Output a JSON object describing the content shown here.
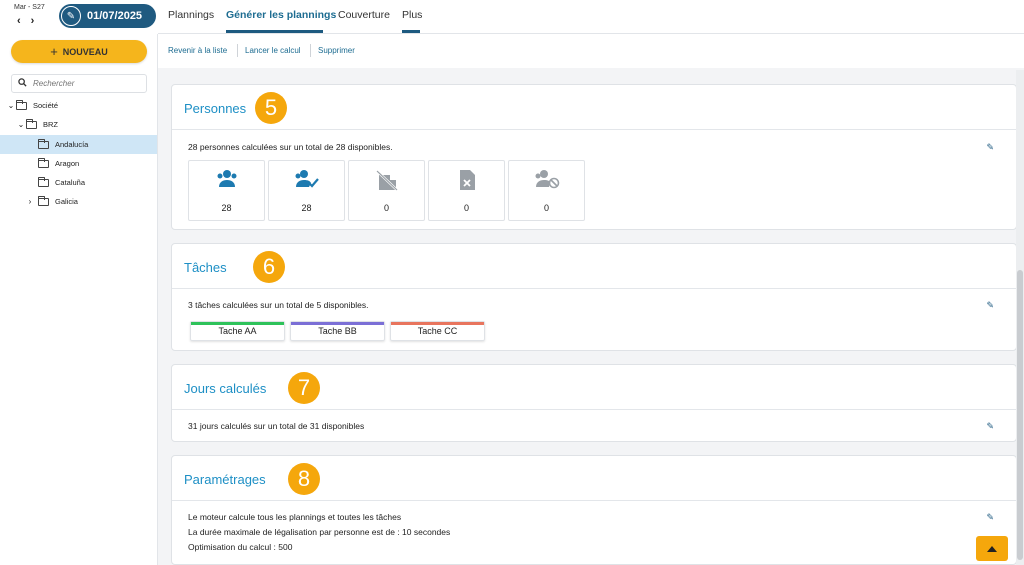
{
  "header": {
    "week_label": "Mar - S27",
    "prev_arrow": "‹",
    "next_arrow": "›",
    "date": "01/07/2025"
  },
  "sidebar": {
    "new_button": "NOUVEAU",
    "search_placeholder": "Rechercher",
    "tree": [
      {
        "label": "Société",
        "expanded": true
      },
      {
        "label": "BRZ",
        "expanded": true
      },
      {
        "label": "Andalucía",
        "selected": true
      },
      {
        "label": "Aragon"
      },
      {
        "label": "Cataluña"
      },
      {
        "label": "Galicia",
        "expanded": false
      }
    ]
  },
  "nav": {
    "tabs": [
      "Plannings",
      "Générer les plannings",
      "Couverture",
      "Plus"
    ],
    "active": "Générer les plannings"
  },
  "subnav": {
    "back": "Revenir à la liste",
    "run": "Lancer le calcul",
    "delete": "Supprimer"
  },
  "sections": {
    "persons": {
      "title": "Personnes",
      "badge": "5",
      "text": "28 personnes calculées sur un total de 28 disponibles.",
      "stats": [
        {
          "icon": "people-icon",
          "value": "28",
          "active": true
        },
        {
          "icon": "people-check-icon",
          "value": "28",
          "active": true
        },
        {
          "icon": "building-off-icon",
          "value": "0",
          "active": false
        },
        {
          "icon": "file-cancel-icon",
          "value": "0",
          "active": false
        },
        {
          "icon": "people-blocked-icon",
          "value": "0",
          "active": false
        }
      ]
    },
    "tasks": {
      "title": "Tâches",
      "badge": "6",
      "text": "3 tâches calculées sur un total de 5 disponibles.",
      "items": [
        {
          "label": "Tache AA",
          "color": "#2ec25a"
        },
        {
          "label": "Tache BB",
          "color": "#7b6fd6"
        },
        {
          "label": "Tache CC",
          "color": "#e8755e"
        }
      ]
    },
    "days": {
      "title": "Jours calculés",
      "badge": "7",
      "text": "31 jours calculés sur un total de 31 disponibles"
    },
    "settings": {
      "title": "Paramétrages",
      "badge": "8",
      "line1": "Le moteur calcule tous les plannings et toutes les tâches",
      "line2": "La durée maximale de légalisation par personne est de :  10  secondes",
      "line3": "Optimisation du calcul :  500"
    }
  },
  "colors": {
    "accent": "#1d8fc5",
    "brand_dark": "#1f5a80",
    "badge": "#f5a70c",
    "new_button": "#f5b51c"
  }
}
